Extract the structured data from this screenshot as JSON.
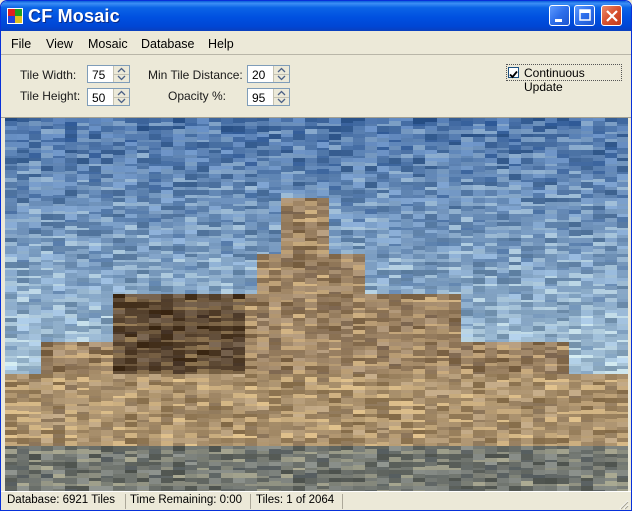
{
  "window": {
    "title": "CF Mosaic"
  },
  "icons": {
    "app": "app-icon",
    "minimize": "minimize-icon",
    "maximize": "maximize-icon",
    "close": "close-icon"
  },
  "menu": [
    "File",
    "View",
    "Mosaic",
    "Database",
    "Help"
  ],
  "controls": {
    "tile_width": {
      "label": "Tile Width:",
      "value": "75"
    },
    "tile_height": {
      "label": "Tile Height:",
      "value": "50"
    },
    "min_tile_distance": {
      "label": "Min Tile Distance:",
      "value": "20"
    },
    "opacity": {
      "label": "Opacity %:",
      "value": "95"
    },
    "continuous_update": {
      "label": "Continuous Update",
      "checked": true
    }
  },
  "status": {
    "database": "Database: 6921 Tiles",
    "time_remaining": "Time Remaining: 0:00",
    "tiles": "Tiles: 1 of 2064"
  },
  "colors": {
    "title_bar": "#0050E0",
    "window_bg": "#ECE9D8",
    "close_button": "#D8512F",
    "sky": "#4F78A8",
    "rock": "#5A4632",
    "sand": "#A88E68"
  }
}
